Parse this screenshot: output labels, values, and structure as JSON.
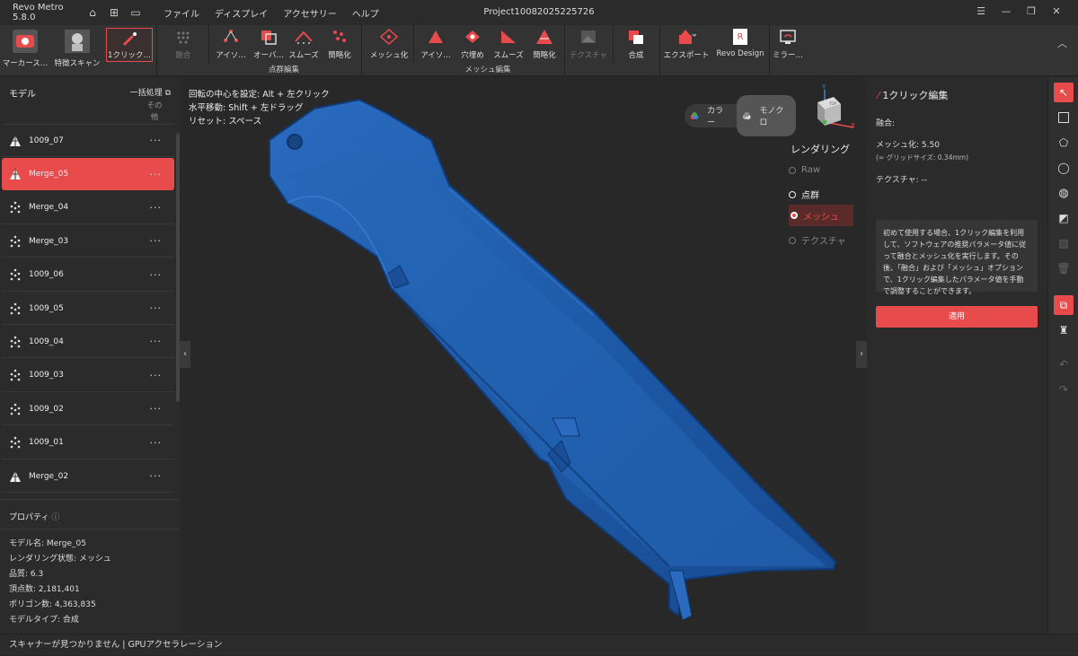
{
  "app": {
    "title": "Revo Metro 5.8.0",
    "project": "Project10082025225726"
  },
  "menu": [
    "ファイル",
    "ディスプレイ",
    "アクセサリー",
    "ヘルプ"
  ],
  "toolbar": {
    "marker_scan": "マーカース…",
    "feature_scan": "特徴スキャン",
    "one_click": "1クリック…",
    "fuse": "融合",
    "iso1": "アイソ…",
    "overlap": "オーバ…",
    "smooth1": "スムーズ",
    "simplify1": "簡略化",
    "pc_group": "点群編集",
    "meshing": "メッシュ化",
    "iso2": "アイソ…",
    "fill_holes": "穴埋め",
    "smooth2": "スムーズ",
    "simplify2": "簡略化",
    "mesh_group": "メッシュ編集",
    "texture": "テクスチャ",
    "merge": "合成",
    "export": "エクスポート",
    "revo_design": "Revo Design",
    "mirror": "ミラー…"
  },
  "left": {
    "header": "モデル",
    "batch": "一括処理",
    "other": "その他",
    "models": [
      {
        "name": "1009_07",
        "type": "mesh"
      },
      {
        "name": "Merge_05",
        "type": "mesh",
        "selected": true
      },
      {
        "name": "Merge_04",
        "type": "points"
      },
      {
        "name": "Merge_03",
        "type": "points"
      },
      {
        "name": "1009_06",
        "type": "points"
      },
      {
        "name": "1009_05",
        "type": "points"
      },
      {
        "name": "1009_04",
        "type": "points"
      },
      {
        "name": "1009_03",
        "type": "points"
      },
      {
        "name": "1009_02",
        "type": "points"
      },
      {
        "name": "1009_01",
        "type": "points"
      },
      {
        "name": "Merge_02",
        "type": "mesh"
      }
    ],
    "props_header": "プロパティ",
    "props": [
      "モデル名: Merge_05",
      "レンダリング状態: メッシュ",
      "品質: 6.3",
      "頂点数: 2,181,401",
      "ポリゴン数: 4,363,835",
      "モデルタイプ: 合成"
    ]
  },
  "viewport": {
    "hints": [
      "回転の中心を設定: Alt + 左クリック",
      "水平移動: Shift + 左ドラッグ",
      "リセット: スペース"
    ],
    "color": "カラー",
    "mono": "モノクロ",
    "render_title": "レンダリング",
    "render_opts": [
      "Raw",
      "点群",
      "メッシュ",
      "テクスチャ"
    ],
    "selected_render": "メッシュ",
    "axis_y": "Y",
    "axis_x": "X",
    "cube": "TOP"
  },
  "right": {
    "title": "1クリック編集",
    "fuse": "融合:",
    "mesh": "メッシュ化: 5.50",
    "grid": "(≈ グリッドサイズ: 0.34mm)",
    "texture": "テクスチャ: --",
    "desc": "初めて使用する場合、1クリック編集を利用して、ソフトウェアの推奨パラメータ値に従って融合とメッシュ化を実行します。その後、「融合」および「メッシュ」オプションで、1クリック編集したパラメータ値を手動で調整することができます。",
    "apply": "適用"
  },
  "status": "スキャナーが見つかりません | GPUアクセラレーション",
  "colors": {
    "accent": "#e84b4b",
    "mesh": "#1e5aa8"
  }
}
